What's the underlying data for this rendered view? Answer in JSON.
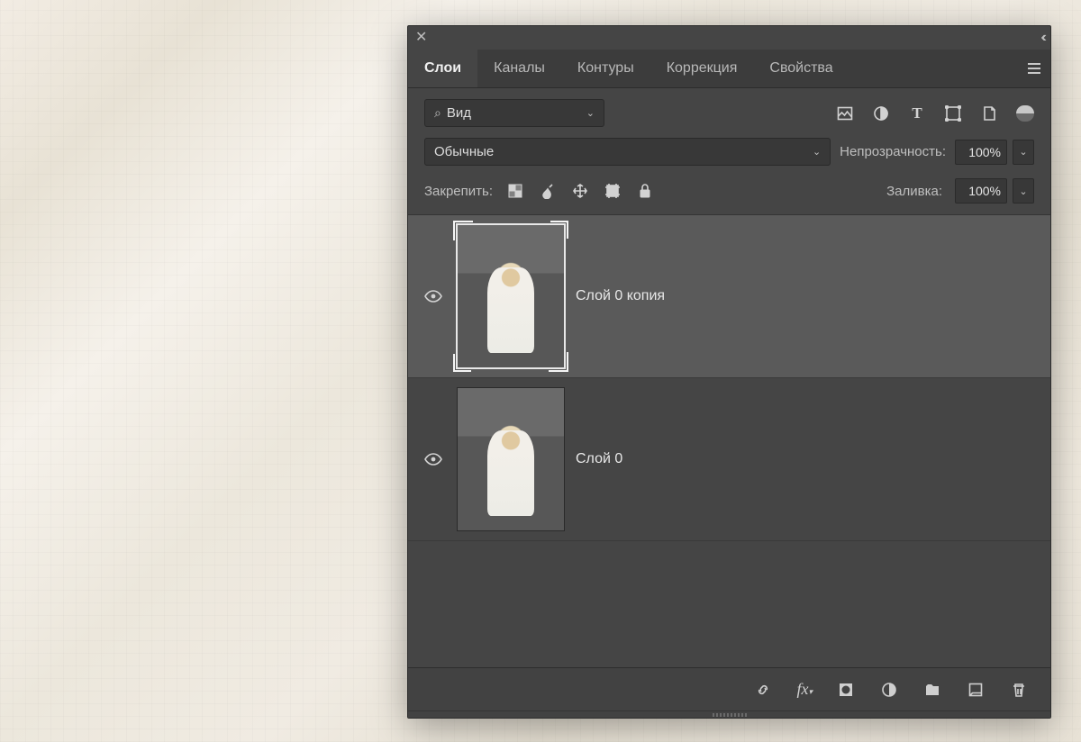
{
  "tabs": [
    "Слои",
    "Каналы",
    "Контуры",
    "Коррекция",
    "Свойства"
  ],
  "activeTab": 0,
  "kindDropdown": {
    "label": "Вид"
  },
  "filterIcons": [
    "image-icon",
    "adjustment-icon",
    "type-icon",
    "shape-icon",
    "smartobject-icon"
  ],
  "blend": {
    "mode": "Обычные",
    "opacityLabel": "Непрозрачность:",
    "opacity": "100%"
  },
  "lock": {
    "label": "Закрепить:",
    "fillLabel": "Заливка:",
    "fill": "100%"
  },
  "layers": [
    {
      "name": "Слой 0 копия",
      "visible": true,
      "selected": true
    },
    {
      "name": "Слой 0",
      "visible": true,
      "selected": false
    }
  ],
  "footerIcons": [
    "link-icon",
    "fx-icon",
    "mask-icon",
    "adjustment-layer-icon",
    "group-icon",
    "new-layer-icon",
    "trash-icon"
  ]
}
